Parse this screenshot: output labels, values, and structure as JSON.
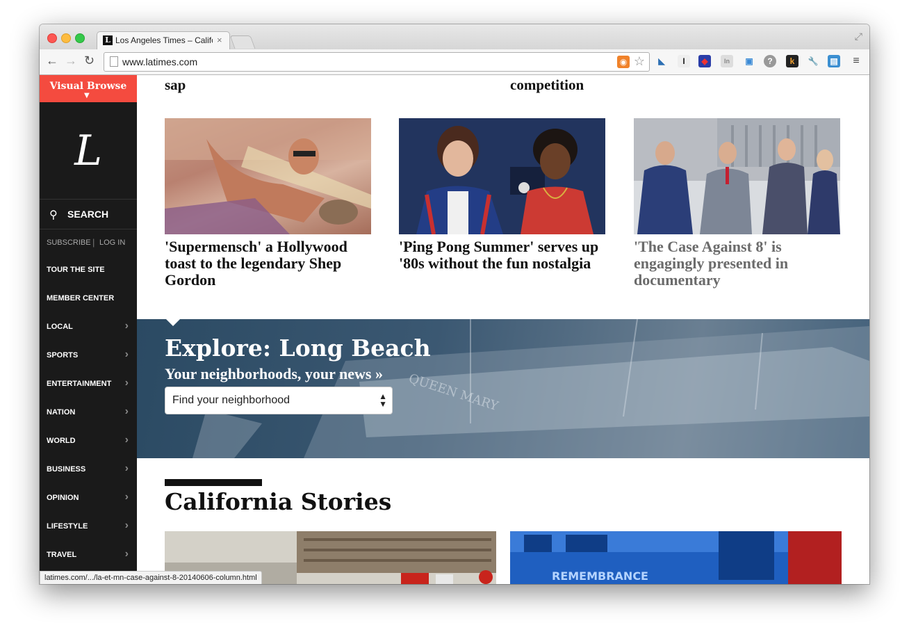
{
  "browser": {
    "tab_title": "Los Angeles Times – Califo",
    "tab_close": "×",
    "favicon_letter": "L",
    "url": "www.latimes.com",
    "status_url": "latimes.com/.../la-et-mn-case-against-8-20140606-column.html",
    "icons": [
      "back-arrow-icon",
      "forward-arrow-icon",
      "reload-icon",
      "page-icon",
      "rss-icon",
      "star-icon",
      "fullscreen-icon",
      "menu-icon"
    ],
    "extensions": [
      "I",
      "In",
      "?",
      "k"
    ]
  },
  "sidebar": {
    "visual_browse": "Visual Browse",
    "logo": "L",
    "search_label": "SEARCH",
    "subscribe": "SUBSCRIBE",
    "separator": "|",
    "login": "LOG IN",
    "items": [
      {
        "label": "TOUR THE SITE",
        "arrow": false
      },
      {
        "label": "MEMBER CENTER",
        "arrow": false
      },
      {
        "label": "LOCAL",
        "arrow": true
      },
      {
        "label": "SPORTS",
        "arrow": true
      },
      {
        "label": "ENTERTAINMENT",
        "arrow": true
      },
      {
        "label": "NATION",
        "arrow": true
      },
      {
        "label": "WORLD",
        "arrow": true
      },
      {
        "label": "BUSINESS",
        "arrow": true
      },
      {
        "label": "OPINION",
        "arrow": true
      },
      {
        "label": "LIFESTYLE",
        "arrow": true
      },
      {
        "label": "TRAVEL",
        "arrow": true
      }
    ],
    "arrow_glyph": "›"
  },
  "main": {
    "top_fragments": [
      "sap",
      "competition"
    ],
    "stories": [
      {
        "headline": "'Supermensch' a Hollywood toast to the legendary Shep Gordon"
      },
      {
        "headline": "'Ping Pong Summer' serves up '80s without the fun nostalgia"
      },
      {
        "headline": "'The Case Against 8' is engagingly presented in documentary"
      }
    ],
    "explore": {
      "title": "Explore: Long Beach",
      "subtitle": "Your neighborhoods, your news »",
      "select_value": "Find your neighborhood"
    },
    "california": {
      "title": "California Stories"
    }
  },
  "colors": {
    "visual_browse_bg": "#f44b3f",
    "sidebar_bg": "#1a1a1a",
    "explore_bg": "#3b5872",
    "hover_headline": "#6b6b6b"
  }
}
